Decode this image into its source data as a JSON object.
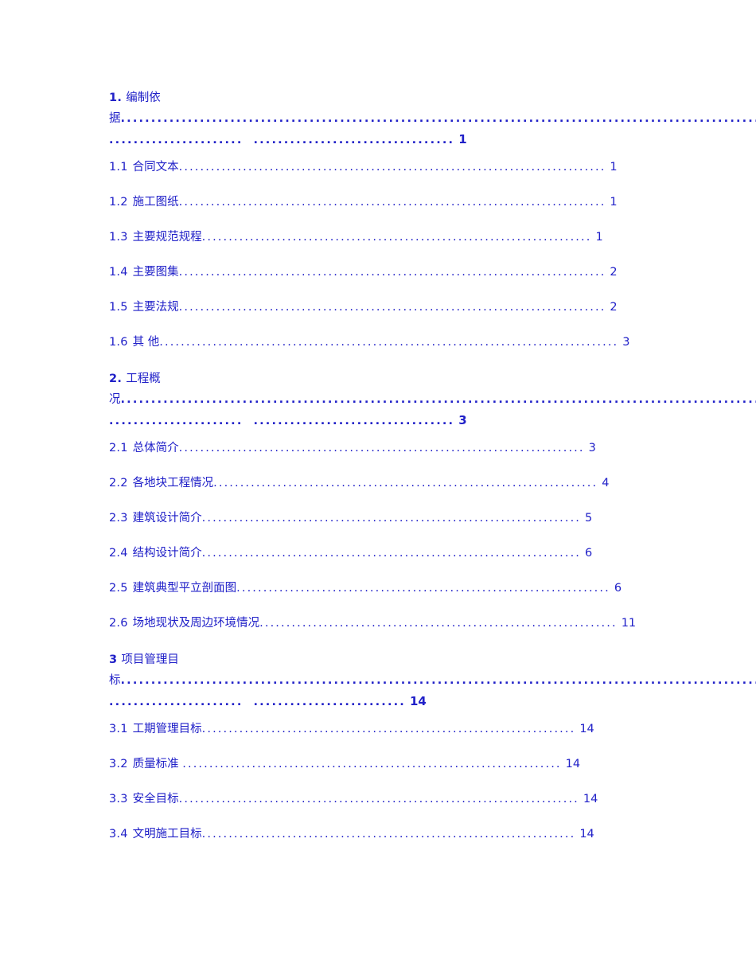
{
  "document": {
    "kind": "table-of-contents",
    "text_color": "#2020c8",
    "page_background": "#ffffff"
  },
  "toc": {
    "entries": [
      {
        "id": "entry-1",
        "level": "major",
        "number": "1.",
        "title": "编制依据",
        "title_line1": "编制依",
        "title_line2": "据",
        "page": "1",
        "leader_long": "...........................................................................................................",
        "leader_seg_a": "......................",
        "leader_seg_b": "................................."
      },
      {
        "id": "entry-1-1",
        "level": "minor",
        "number": "1.1",
        "title": "合同文本",
        "page": "1",
        "leader": "................................................................................"
      },
      {
        "id": "entry-1-2",
        "level": "minor",
        "number": "1.2",
        "title": "施工图纸",
        "page": "1",
        "leader": "................................................................................"
      },
      {
        "id": "entry-1-3",
        "level": "minor",
        "number": "1.3",
        "title": "主要规范规程",
        "page": "1",
        "leader": "........................................................................."
      },
      {
        "id": "entry-1-4",
        "level": "minor",
        "number": "1.4",
        "title": "主要图集",
        "page": "2",
        "leader": "................................................................................"
      },
      {
        "id": "entry-1-5",
        "level": "minor",
        "number": "1.5",
        "title": "主要法规",
        "page": "2",
        "leader": "................................................................................"
      },
      {
        "id": "entry-1-6",
        "level": "minor",
        "number": "1.6",
        "title": "其 他",
        "page": "3",
        "leader": "......................................................................................"
      },
      {
        "id": "entry-2",
        "level": "major",
        "number": "2.",
        "title": "工程概况",
        "title_line1": "工程概",
        "title_line2": "况",
        "page": "3",
        "leader_long": "...........................................................................................................",
        "leader_seg_a": "......................",
        "leader_seg_b": "................................."
      },
      {
        "id": "entry-2-1",
        "level": "minor",
        "number": "2.1",
        "title": "总体简介",
        "page": "3",
        "leader": "............................................................................"
      },
      {
        "id": "entry-2-2",
        "level": "minor",
        "number": "2.2",
        "title": "各地块工程情况",
        "page": "4",
        "leader": "........................................................................"
      },
      {
        "id": "entry-2-3",
        "level": "minor",
        "number": "2.3",
        "title": "建筑设计简介",
        "page": "5",
        "leader": "......................................................................."
      },
      {
        "id": "entry-2-4",
        "level": "minor",
        "number": "2.4",
        "title": "结构设计简介",
        "page": "6",
        "leader": "......................................................................."
      },
      {
        "id": "entry-2-5",
        "level": "minor",
        "number": "2.5",
        "title": "建筑典型平立剖面图",
        "page": "6",
        "leader": "......................................................................"
      },
      {
        "id": "entry-2-6",
        "level": "minor",
        "number": "2.6",
        "title": "场地现状及周边环境情况",
        "page": "11",
        "leader": "..................................................................."
      },
      {
        "id": "entry-3",
        "level": "major",
        "number": "3",
        "title": "项目管理目标",
        "title_line1": "项目管理目",
        "title_line2": "标",
        "page": "14",
        "leader_long": "...........................................................................................................",
        "leader_seg_a": "......................",
        "leader_seg_b": "........................."
      },
      {
        "id": "entry-3-1",
        "level": "minor",
        "number": "3.1",
        "title": "工期管理目标",
        "page": "14",
        "leader": "......................................................................"
      },
      {
        "id": "entry-3-2",
        "level": "minor",
        "number": "3.2",
        "title": "质量标准 ",
        "page": "14",
        "leader": "......................................................................."
      },
      {
        "id": "entry-3-3",
        "level": "minor",
        "number": "3.3",
        "title": "安全目标",
        "page": "14",
        "leader": "..........................................................................."
      },
      {
        "id": "entry-3-4",
        "level": "minor",
        "number": "3.4",
        "title": "文明施工目标",
        "page": "14",
        "leader": "......................................................................"
      }
    ]
  }
}
